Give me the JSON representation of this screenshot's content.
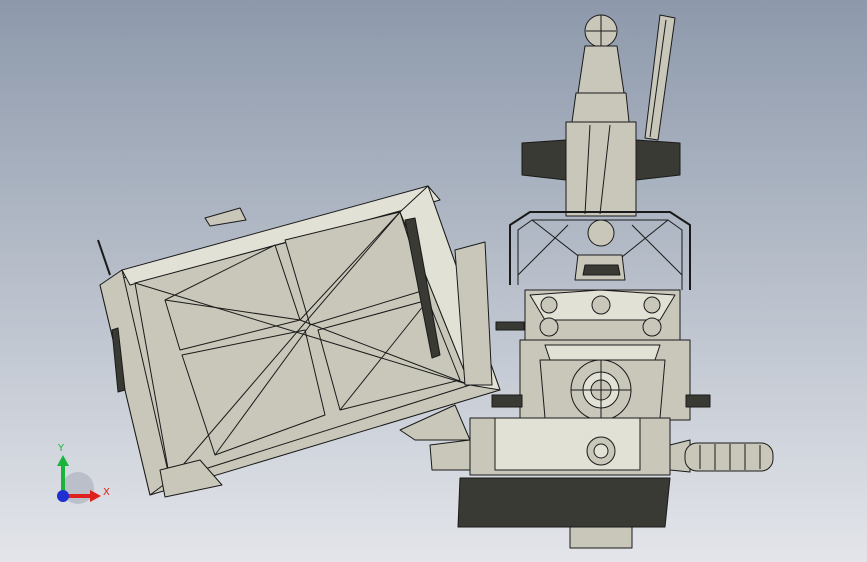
{
  "viewport": {
    "background_top": "#8d99ab",
    "background_bottom": "#e3e5ea",
    "model_fill": "#c8c7ba",
    "model_fill_light": "#e2e1d6",
    "model_edge": "#1a1a1a",
    "model_dark": "#3a3a34"
  },
  "triad": {
    "x_label": "X",
    "y_label": "Y",
    "x_color": "#e0201c",
    "y_color": "#18b43c",
    "z_color": "#1f2fd0"
  }
}
